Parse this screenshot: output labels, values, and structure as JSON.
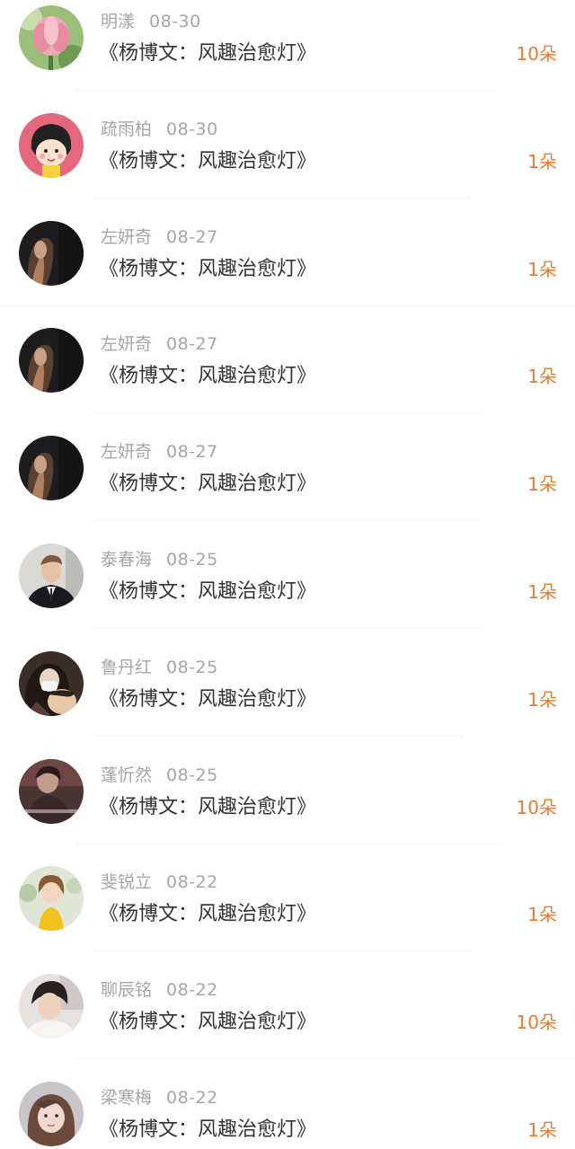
{
  "colors": {
    "name": "#a6a6a6",
    "title": "#333333",
    "count": "#ec7a2e",
    "divider": "#f0f0f0"
  },
  "records": [
    {
      "name": "明漾",
      "date": "08-30",
      "title": "《杨博文：风趣治愈灯》",
      "count": "10朵",
      "avatar": "lotus-flower-avatar"
    },
    {
      "name": "疏雨柏",
      "date": "08-30",
      "title": "《杨博文：风趣治愈灯》",
      "count": "1朵",
      "avatar": "cartoon-girl-avatar"
    },
    {
      "name": "左妍奇",
      "date": "08-27",
      "title": "《杨博文：风趣治愈灯》",
      "count": "1朵",
      "avatar": "dark-portrait-avatar"
    },
    {
      "name": "左妍奇",
      "date": "08-27",
      "title": "《杨博文：风趣治愈灯》",
      "count": "1朵",
      "avatar": "dark-portrait-avatar"
    },
    {
      "name": "左妍奇",
      "date": "08-27",
      "title": "《杨博文：风趣治愈灯》",
      "count": "1朵",
      "avatar": "dark-portrait-avatar"
    },
    {
      "name": "泰春海",
      "date": "08-25",
      "title": "《杨博文：风趣治愈灯》",
      "count": "1朵",
      "avatar": "suit-man-avatar"
    },
    {
      "name": "鲁丹红",
      "date": "08-25",
      "title": "《杨博文：风趣治愈灯》",
      "count": "1朵",
      "avatar": "mother-child-avatar"
    },
    {
      "name": "蓬忻然",
      "date": "08-25",
      "title": "《杨博文：风趣治愈灯》",
      "count": "10朵",
      "avatar": "moody-photo-avatar"
    },
    {
      "name": "斐锐立",
      "date": "08-22",
      "title": "《杨博文：风趣治愈灯》",
      "count": "1朵",
      "avatar": "little-girl-avatar"
    },
    {
      "name": "聊辰铭",
      "date": "08-22",
      "title": "《杨博文：风趣治愈灯》",
      "count": "10朵",
      "avatar": "young-man-avatar"
    },
    {
      "name": "梁寒梅",
      "date": "08-22",
      "title": "《杨博文：风趣治愈灯》",
      "count": "1朵",
      "avatar": "girl-portrait-avatar"
    }
  ]
}
